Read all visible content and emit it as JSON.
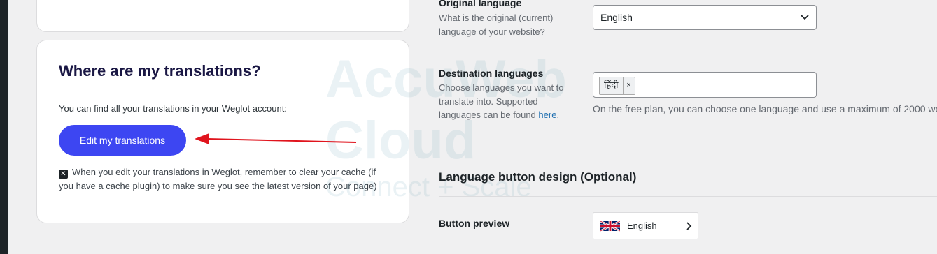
{
  "card": {
    "title": "Where are my translations?",
    "text": "You can find all your translations in your Weglot account:",
    "button_label": "Edit my translations",
    "note": "When you edit your translations in Weglot, remember to clear your cache (if you have a cache plugin) to make sure you see the latest version of your page)"
  },
  "original_language": {
    "label": "Original language",
    "description": "What is the original (current) language of your website?",
    "value": "English"
  },
  "destination_languages": {
    "label": "Destination languages",
    "description_prefix": "Choose languages you want to translate into. Supported languages can be found ",
    "link_text": "here",
    "description_suffix": ".",
    "selected": [
      "हिंदी"
    ],
    "remove_symbol": "×",
    "help": "On the free plan, you can choose one language and use a maximum of 2000 wo"
  },
  "language_button_design": {
    "title": "Language button design (Optional)",
    "preview_label": "Button preview",
    "preview_language": "English"
  },
  "watermark": {
    "line1": "AccuWeb",
    "line2": "Cloud",
    "line3": "Connect + Scale"
  },
  "colors": {
    "button": "#3d46f2",
    "arrow": "#e0141d",
    "title": "#1a1744"
  },
  "icons": [
    "close-square-icon",
    "chevron-down-icon",
    "uk-flag-icon",
    "chevron-right-icon",
    "red-arrow-annotation"
  ]
}
